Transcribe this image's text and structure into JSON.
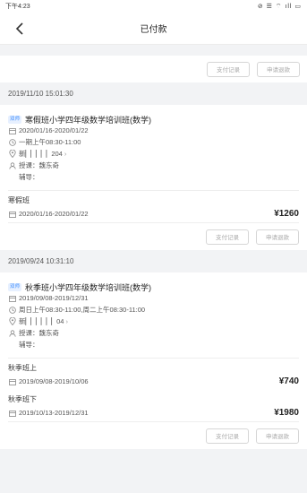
{
  "statusbar": {
    "time": "下午4:23",
    "icons": "⊘ ☰ ⌔ ıll ▭"
  },
  "nav": {
    "title": "已付款"
  },
  "buttons": {
    "pay_record": "支付记录",
    "refund": "申请退款"
  },
  "orders": [
    {
      "datetime": "2019/11/10 15:01:30",
      "tag": "双师",
      "course": "寒假班小学四年级数学培训班(数学)",
      "date_range": "2020/01/16-2020/01/22",
      "schedule": "一期上午08:30-11:00",
      "location": "新▏▏▏▏▏204",
      "teacher": "授课：魏东奇",
      "helper": "辅导：",
      "items": [
        {
          "name": "寒假班",
          "date_range": "2020/01/16-2020/01/22",
          "price": "¥1260"
        }
      ]
    },
    {
      "datetime": "2019/09/24 10:31:10",
      "tag": "双师",
      "course": "秋季班小学四年级数学培训班(数学)",
      "date_range": "2019/09/08-2019/12/31",
      "schedule": "周日上午08:30-11:00,周二上午08:30-11:00",
      "location": "新▏▏▏▏▏▏04",
      "teacher": "授课：魏东奇",
      "helper": "辅导：",
      "items": [
        {
          "name": "秋季班上",
          "date_range": "2019/09/08-2019/10/06",
          "price": "¥740"
        },
        {
          "name": "秋季班下",
          "date_range": "2019/10/13-2019/12/31",
          "price": "¥1980"
        }
      ]
    }
  ]
}
